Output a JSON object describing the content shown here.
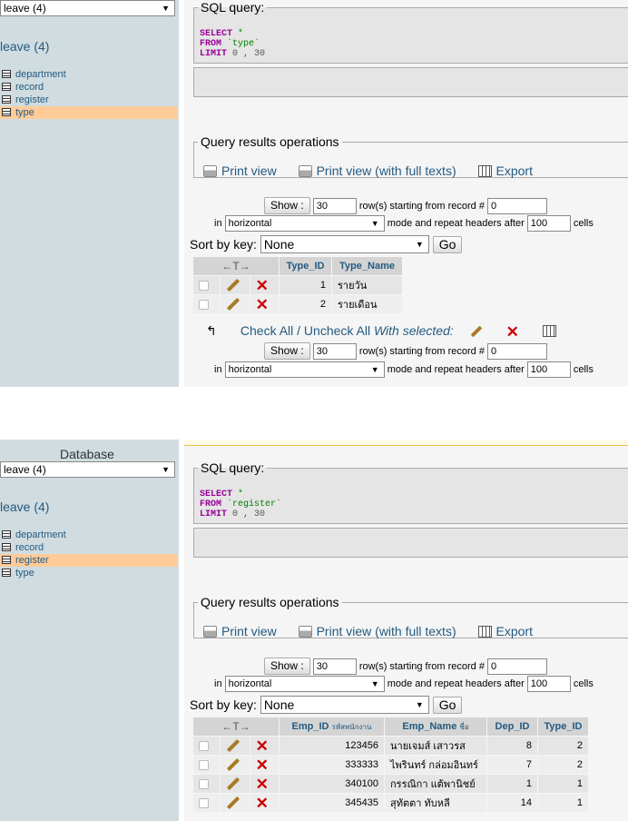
{
  "panel1": {
    "sidebar": {
      "db_select": "leave (4)",
      "db_title": "leave (4)",
      "tables": [
        "department",
        "record",
        "register",
        "type"
      ],
      "active": "type"
    },
    "sql": {
      "legend": "SQL query:",
      "select": "SELECT",
      "star": " *",
      "from": "FROM",
      "table": " `type`",
      "limit": "LIMIT",
      "limit_vals": " 0 , 30"
    },
    "ops": {
      "legend": "Query results operations",
      "print": "Print view",
      "print_full": "Print view (with full texts)",
      "export": "Export"
    },
    "nav": {
      "show": "Show :",
      "rows": "30",
      "starting": "row(s) starting from record #",
      "start": "0",
      "in": "in",
      "mode": "horizontal",
      "mode_text": "mode and repeat headers after",
      "repeat": "100",
      "cells": "cells",
      "sort_label": "Sort by key:",
      "sort_value": "None",
      "go": "Go"
    },
    "table": {
      "arrows": "←T→",
      "columns": [
        "Type_ID",
        "Type_Name"
      ],
      "rows": [
        [
          "1",
          "รายวัน"
        ],
        [
          "2",
          "รายเดือน"
        ]
      ]
    },
    "withsel": {
      "check_all": "Check All",
      "sep": " / ",
      "uncheck_all": "Uncheck All",
      "with_selected": "With selected:"
    }
  },
  "panel2": {
    "sidebar": {
      "db_label": "Database",
      "db_select": "leave (4)",
      "db_title": "leave (4)",
      "tables": [
        "department",
        "record",
        "register",
        "type"
      ],
      "active": "register"
    },
    "sql": {
      "legend": "SQL query:",
      "select": "SELECT",
      "star": " *",
      "from": "FROM",
      "table": " `register`",
      "limit": "LIMIT",
      "limit_vals": " 0 , 30"
    },
    "ops": {
      "legend": "Query results operations",
      "print": "Print view",
      "print_full": "Print view (with full texts)",
      "export": "Export"
    },
    "nav": {
      "show": "Show :",
      "rows": "30",
      "starting": "row(s) starting from record #",
      "start": "0",
      "in": "in",
      "mode": "horizontal",
      "mode_text": "mode and repeat headers after",
      "repeat": "100",
      "cells": "cells",
      "sort_label": "Sort by key:",
      "sort_value": "None",
      "go": "Go"
    },
    "table": {
      "arrows": "←T→",
      "emp_id": "Emp_ID",
      "emp_id_sub": "รหัสพนักงาน",
      "emp_name": "Emp_Name",
      "emp_name_sub": "ชื่อ",
      "dep_id": "Dep_ID",
      "type_id": "Type_ID",
      "rows": [
        [
          "123456",
          "นายเจมส์ เสาวรส",
          "8",
          "2"
        ],
        [
          "333333",
          "ไพรินทร์ กล่อมอินทร์",
          "7",
          "2"
        ],
        [
          "340100",
          "กรรณิกา แต้พานิชย์",
          "1",
          "1"
        ],
        [
          "345435",
          "สุทัตตา ทับหลี",
          "14",
          "1"
        ]
      ]
    }
  }
}
